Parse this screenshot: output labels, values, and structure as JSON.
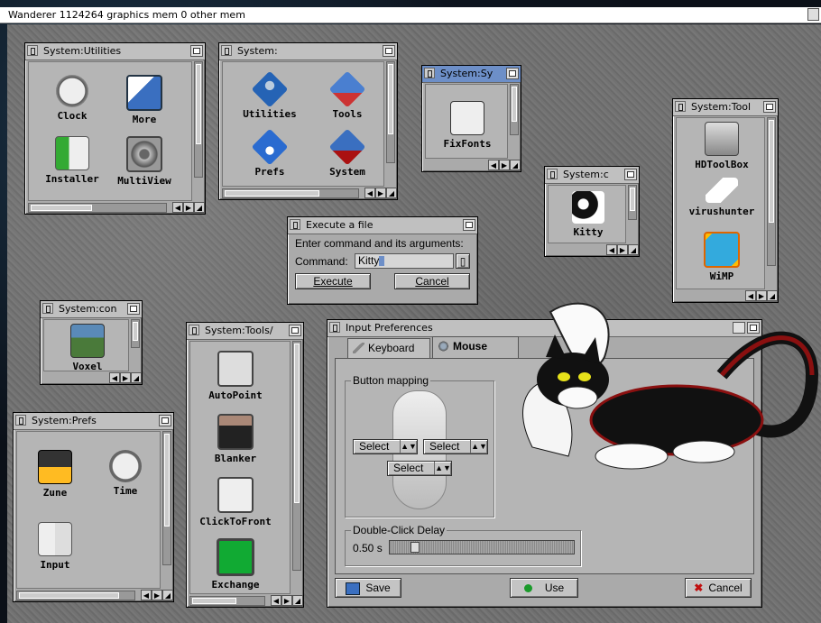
{
  "screen": {
    "title": "Wanderer  1124264 graphics mem  0 other mem"
  },
  "windows": {
    "utilities": {
      "title": "System:Utilities",
      "icons": [
        {
          "label": "Clock",
          "icon": "clock-icon"
        },
        {
          "label": "More",
          "icon": "more-icon"
        },
        {
          "label": "Installer",
          "icon": "installer-icon"
        },
        {
          "label": "MultiView",
          "icon": "multiview-icon"
        }
      ]
    },
    "system": {
      "title": "System:",
      "icons": [
        {
          "label": "Utilities",
          "icon": "drawer-icon"
        },
        {
          "label": "Tools",
          "icon": "drawer-icon"
        },
        {
          "label": "Prefs",
          "icon": "drawer-icon"
        },
        {
          "label": "System",
          "icon": "drawer-icon"
        }
      ]
    },
    "sys": {
      "title": "System:Sy",
      "icons": [
        {
          "label": "FixFonts",
          "icon": "fixfonts-icon"
        }
      ]
    },
    "c": {
      "title": "System:c",
      "icons": [
        {
          "label": "Kitty",
          "icon": "kitty-icon"
        }
      ]
    },
    "tool": {
      "title": "System:Tool",
      "icons": [
        {
          "label": "HDToolBox",
          "icon": "hdtoolbox-icon"
        },
        {
          "label": "virushunter",
          "icon": "virushunter-icon"
        },
        {
          "label": "WiMP",
          "icon": "wimp-icon"
        }
      ]
    },
    "con": {
      "title": "System:con",
      "icons": [
        {
          "label": "Voxel",
          "icon": "voxel-icon"
        }
      ]
    },
    "prefs": {
      "title": "System:Prefs",
      "icons": [
        {
          "label": "Zune",
          "icon": "zune-icon"
        },
        {
          "label": "Time",
          "icon": "time-icon"
        },
        {
          "label": "Input",
          "icon": "input-icon"
        }
      ]
    },
    "tools2": {
      "title": "System:Tools/",
      "icons": [
        {
          "label": "AutoPoint",
          "icon": "autopoint-icon"
        },
        {
          "label": "Blanker",
          "icon": "blanker-icon"
        },
        {
          "label": "ClickToFront",
          "icon": "clicktofront-icon"
        },
        {
          "label": "Exchange",
          "icon": "exchange-icon"
        }
      ]
    }
  },
  "execute": {
    "title": "Execute a file",
    "prompt": "Enter command and its arguments:",
    "command_label": "Command:",
    "command_value": "Kitty",
    "execute_label": "Execute",
    "cancel_label": "Cancel"
  },
  "input_prefs": {
    "title": "Input Preferences",
    "tabs": [
      {
        "label": "Keyboard"
      },
      {
        "label": "Mouse"
      }
    ],
    "button_mapping_label": "Button mapping",
    "select_left": "Select",
    "select_right": "Select",
    "select_middle": "Select",
    "dblclick_label": "Double-Click Delay",
    "dblclick_value": "0.50 s",
    "dblclick_fraction": 0.12,
    "save_label": "Save",
    "use_label": "Use",
    "cancel_label": "Cancel"
  },
  "colors": {
    "title_active": "#6d8fc8",
    "window_bg": "#aaaaaa",
    "accent_green": "#1a9a2a",
    "cancel_red": "#c01010"
  }
}
